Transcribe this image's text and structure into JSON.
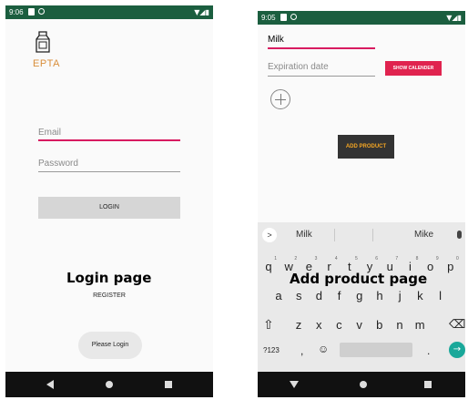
{
  "left": {
    "statusbar": {
      "time": "9:06",
      "right": "▼◢▮"
    },
    "logo_text": "EPTA",
    "email_placeholder": "Email",
    "password_placeholder": "Password",
    "login_label": "LOGIN",
    "caption": "Login page",
    "register_label": "REGISTER",
    "toast": "Please Login"
  },
  "right": {
    "statusbar": {
      "time": "9:05",
      "right": "▼◢▮"
    },
    "product_value": "Milk",
    "expiration_placeholder": "Expiration date",
    "calendar_label": "SHOW CALENDER",
    "add_label": "ADD PRODUCT",
    "caption": "Add product page",
    "keyboard": {
      "suggestions": [
        "Milk",
        "Mike"
      ],
      "row1": [
        "q",
        "w",
        "e",
        "r",
        "t",
        "y",
        "u",
        "i",
        "o",
        "p"
      ],
      "row1_hints": [
        "1",
        "2",
        "3",
        "4",
        "5",
        "6",
        "7",
        "8",
        "9",
        "0"
      ],
      "row2": [
        "a",
        "s",
        "d",
        "f",
        "g",
        "h",
        "j",
        "k",
        "l"
      ],
      "row3": [
        "z",
        "x",
        "c",
        "v",
        "b",
        "n",
        "m"
      ],
      "symbols_label": "?123",
      "comma": ",",
      "period": ".",
      "emoji": "☺",
      "shift": "⇧",
      "backspace": "⌫",
      "enter": "→",
      "chevron": ">"
    }
  },
  "colors": {
    "statusbar": "#1b5e3f",
    "accent": "#d81b60",
    "logo": "#d98e3a",
    "calendar_button": "#e0234f",
    "add_button_text": "#f5a623",
    "enter_key": "#1aa89a"
  }
}
